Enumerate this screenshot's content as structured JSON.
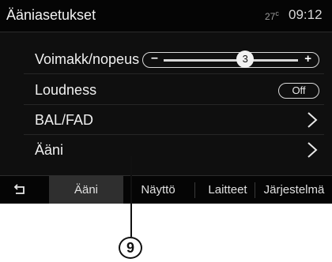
{
  "header": {
    "title": "Ääniasetukset",
    "temperature": "27",
    "clock": "09:12"
  },
  "settings": {
    "volume_speed": {
      "label": "Voimakk/nopeus",
      "minus": "–",
      "plus": "+",
      "value": "3",
      "level": 0.6
    },
    "loudness": {
      "label": "Loudness",
      "state": "Off"
    },
    "bal_fad": {
      "label": "BAL/FAD"
    },
    "sound": {
      "label": "Ääni"
    }
  },
  "tabs": [
    {
      "label": "Ääni",
      "active": true
    },
    {
      "label": "Näyttö",
      "active": false
    },
    {
      "label": "Laitteet",
      "active": false
    },
    {
      "label": "Järjestelmä",
      "active": false
    }
  ],
  "callout": {
    "number": "9"
  },
  "colors": {
    "background": "#0f0f0f",
    "text": "#f0f0f0",
    "accent": "#ffffff",
    "tab_active": "#2f2f2f"
  },
  "icons": {
    "back": "back-arrow-icon",
    "chevron": "chevron-right-icon"
  }
}
